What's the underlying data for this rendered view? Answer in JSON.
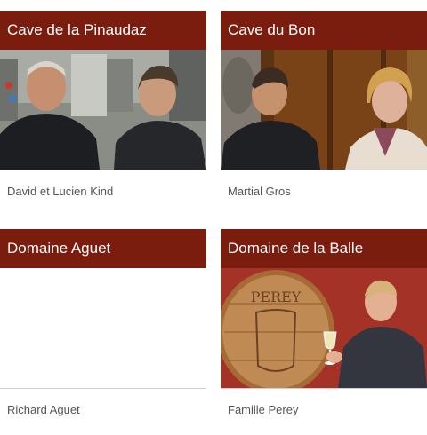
{
  "cards": [
    {
      "title": "Cave de la Pinaudaz",
      "caption": "David et Lucien Kind",
      "photo": "winemakers-in-cellar-photo"
    },
    {
      "title": "Cave du Bon",
      "caption": "Martial Gros",
      "photo": "couple-by-barrels-photo"
    },
    {
      "title": "Domaine Aguet",
      "caption": "Richard Aguet",
      "photo": "empty-photo"
    },
    {
      "title": "Domaine de la Balle",
      "caption": "Famille Perey",
      "photo": "man-with-barrel-photo",
      "barrel_text": "PEREY"
    }
  ],
  "colors": {
    "header_bg": "#7a1c0e",
    "header_text": "#ffffff",
    "caption_text": "#555555"
  }
}
